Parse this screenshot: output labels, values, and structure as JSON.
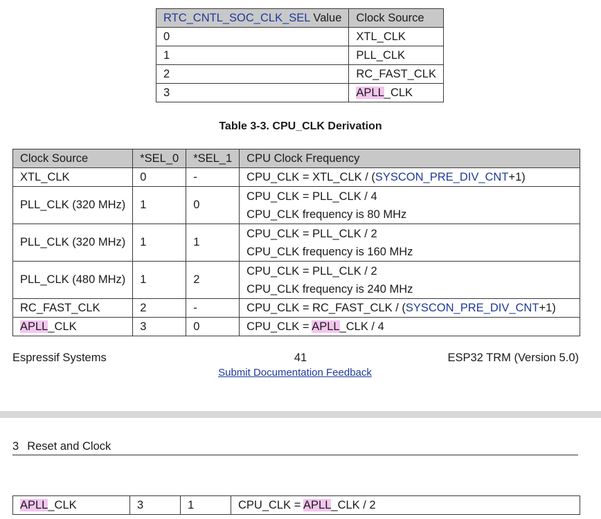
{
  "sel_table": {
    "headers": {
      "c1_link": "RTC_CNTL_SOC_CLK_SEL",
      "c1_suffix": " Value",
      "c2": "Clock Source"
    },
    "rows": [
      {
        "value": "0",
        "source": "XTL_CLK"
      },
      {
        "value": "1",
        "source": "PLL_CLK"
      },
      {
        "value": "2",
        "source": "RC_FAST_CLK"
      },
      {
        "value": "3",
        "source_hl": "APLL",
        "source_rest": "_CLK"
      }
    ]
  },
  "caption": "Table 3-3. CPU_CLK Derivation",
  "cpu_table": {
    "headers": [
      "Clock Source",
      "*SEL_0",
      "*SEL_1",
      "CPU Clock Frequency"
    ],
    "rows": [
      {
        "source": "XTL_CLK",
        "sel0": "0",
        "sel1": "-",
        "f_pre": "CPU_CLK = XTL_CLK / (",
        "f_link": "SYSCON_PRE_DIV_CNT",
        "f_post": "+1)"
      },
      {
        "source": "PLL_CLK (320 MHz)",
        "sel0": "1",
        "sel1": "0",
        "line1": "CPU_CLK = PLL_CLK / 4",
        "line2": "CPU_CLK frequency is 80 MHz"
      },
      {
        "source": "PLL_CLK (320 MHz)",
        "sel0": "1",
        "sel1": "1",
        "line1": "CPU_CLK = PLL_CLK / 2",
        "line2": "CPU_CLK frequency is 160 MHz"
      },
      {
        "source": "PLL_CLK (480 MHz)",
        "sel0": "1",
        "sel1": "2",
        "line1": "CPU_CLK = PLL_CLK / 2",
        "line2": "CPU_CLK frequency is 240 MHz"
      },
      {
        "source": "RC_FAST_CLK",
        "sel0": "2",
        "sel1": "-",
        "f_pre": "CPU_CLK = RC_FAST_CLK / (",
        "f_link": "SYSCON_PRE_DIV_CNT",
        "f_post": "+1)"
      },
      {
        "source_hl": "APLL",
        "source_rest": "_CLK",
        "sel0": "3",
        "sel1": "0",
        "f_pre": "CPU_CLK = ",
        "f_hl": "APLL",
        "f_post": "_CLK / 4"
      }
    ],
    "continued_row": {
      "source_hl": "APLL",
      "source_rest": "_CLK",
      "sel0": "3",
      "sel1": "1",
      "f_pre": "CPU_CLK = ",
      "f_hl": "APLL",
      "f_post": "_CLK / 2"
    }
  },
  "footer": {
    "company": "Espressif Systems",
    "page_number": "41",
    "doc_title": "ESP32 TRM (Version 5.0)",
    "feedback_link": "Submit Documentation Feedback"
  },
  "section_header": {
    "number": "3",
    "title": "Reset and Clock"
  },
  "colors": {
    "link": "#1f3a9a",
    "highlight": "#f4c6ef",
    "header_bg": "#c8c8c8"
  }
}
